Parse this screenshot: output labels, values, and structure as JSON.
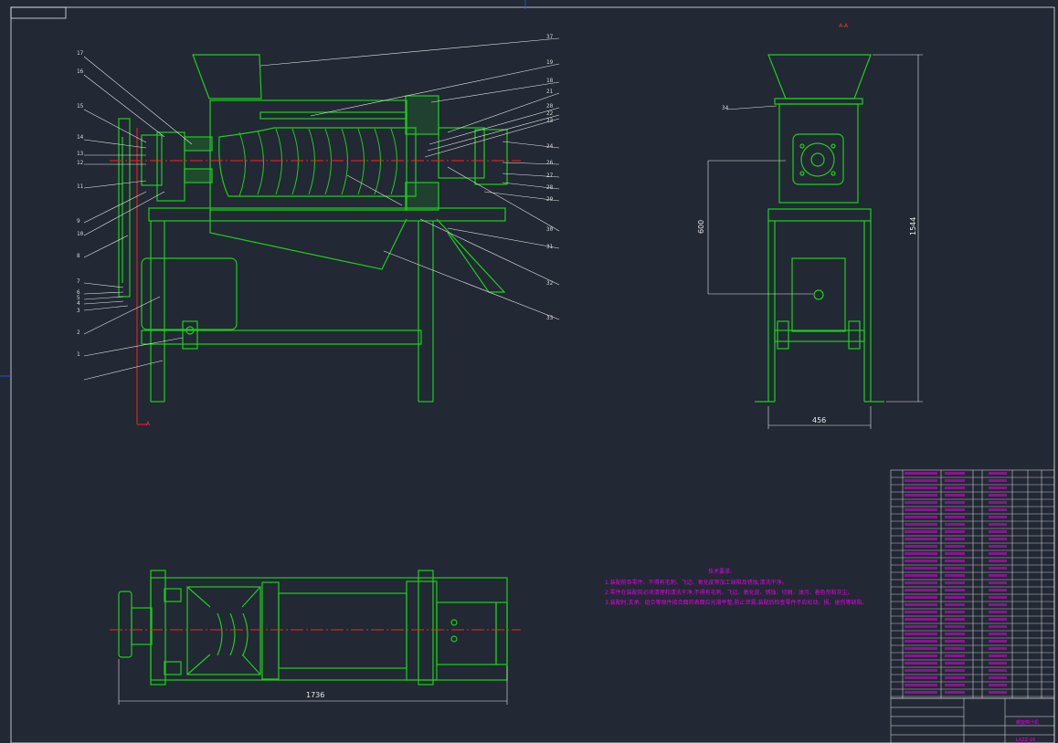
{
  "drawing": {
    "section_label": "A-A",
    "side_callout_label": "A",
    "front_view_labels": [
      "17",
      "16",
      "15",
      "14",
      "13",
      "12",
      "11",
      "9",
      "10",
      "8",
      "7",
      "6",
      "5",
      "4",
      "3",
      "2",
      "1"
    ],
    "right_side_labels": [
      "37",
      "19",
      "18",
      "21",
      "20",
      "22",
      "23",
      "24",
      "26",
      "27",
      "28",
      "29",
      "30",
      "31",
      "32",
      "33"
    ],
    "side_view_label": "34",
    "dimensions": {
      "side_height": "600",
      "overall_height": "1544",
      "side_width": "456",
      "plan_length": "1736"
    },
    "tech_notes": {
      "title": "技术要求:",
      "lines": [
        "1.装配前各零件、不得有毛刺、飞边、氧化皮等加工缺陷及锈蚀,清洗干净。",
        "2.零件在装配前必须清理和清洗干净,不得有毛刺、飞边、氧化皮、锈蚀、切屑、油污、着色剂和灰尘。",
        "3.装配时,支承、组合等原件接合面的表面应光滑平整,防止泄漏,装配后检查零件不应松动、损、碰伤等缺陷。"
      ]
    },
    "title_block": {
      "name": "螺旋榨汁机",
      "code": "LXZZ-16"
    }
  }
}
